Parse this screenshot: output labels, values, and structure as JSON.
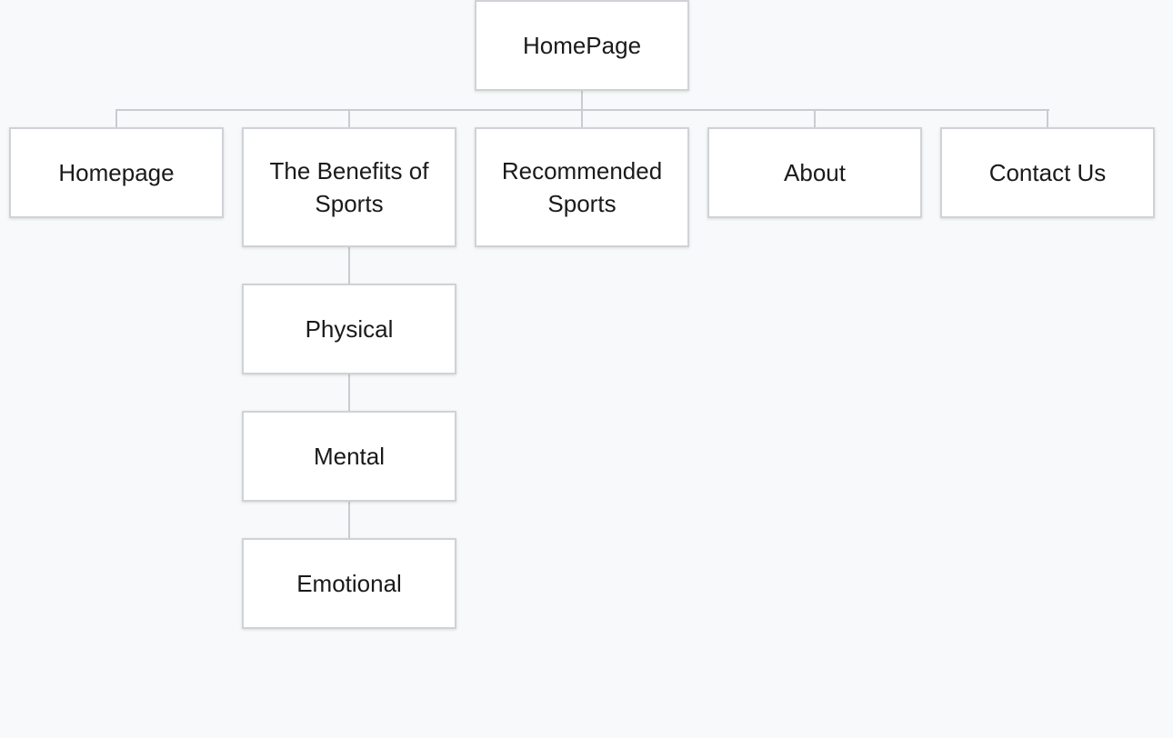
{
  "diagram": {
    "root": {
      "label": "HomePage"
    },
    "children": [
      {
        "label": "Homepage"
      },
      {
        "label": "The Benefits of Sports"
      },
      {
        "label": "Recommended Sports"
      },
      {
        "label": "About"
      },
      {
        "label": "Contact Us"
      }
    ],
    "benefits_subpages": [
      {
        "label": "Physical"
      },
      {
        "label": "Mental"
      },
      {
        "label": "Emotional"
      }
    ]
  }
}
